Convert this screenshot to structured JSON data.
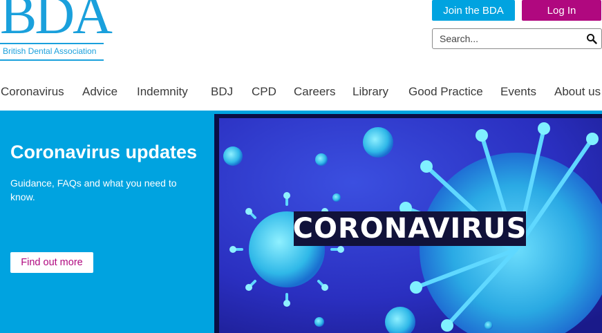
{
  "logo": {
    "abbr": "BDA",
    "name": "British Dental Association"
  },
  "header": {
    "join_label": "Join the BDA",
    "login_label": "Log In"
  },
  "search": {
    "placeholder": "Search..."
  },
  "nav": {
    "items": [
      "Coronavirus",
      "Advice",
      "Indemnity",
      "BDJ",
      "CPD",
      "Careers",
      "Library",
      "Good Practice",
      "Events",
      "About us"
    ]
  },
  "hero": {
    "title": "Coronavirus updates",
    "subtitle": "Guidance, FAQs and what you need to know.",
    "cta_label": "Find out more",
    "image_label": "CORONAVIRUS"
  },
  "colors": {
    "brand_blue": "#00a3e0",
    "brand_magenta": "#b0087f",
    "logo_blue": "#1aa0dc"
  }
}
